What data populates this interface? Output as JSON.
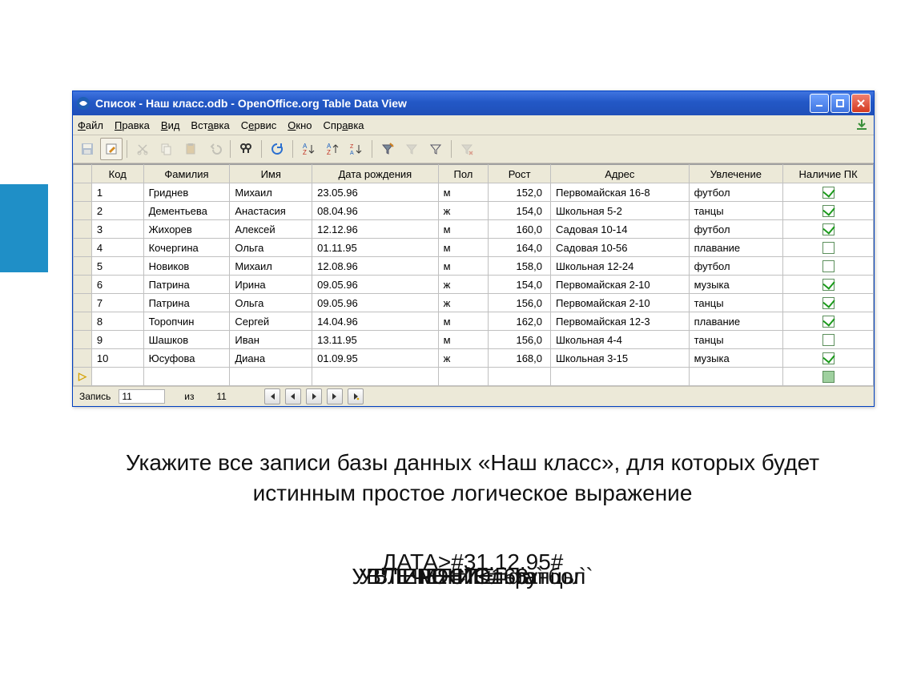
{
  "window": {
    "title": "Список  - Наш класс.odb - OpenOffice.org Table Data View"
  },
  "menu": {
    "file": "Файл",
    "edit": "Правка",
    "view": "Вид",
    "insert": "Вставка",
    "tools": "Сервис",
    "window": "Окно",
    "help": "Справка"
  },
  "columns": {
    "code": "Код",
    "surname": "Фамилия",
    "name": "Имя",
    "birth": "Дата рождения",
    "sex": "Пол",
    "height": "Рост",
    "address": "Адрес",
    "hobby": "Увлечение",
    "pc": "Наличие ПК"
  },
  "rows": [
    {
      "code": "1",
      "surname": "Гриднев",
      "name": "Михаил",
      "birth": "23.05.96",
      "sex": "м",
      "height": "152,0",
      "address": "Первомайская 16-8",
      "hobby": "футбол",
      "pc": true
    },
    {
      "code": "2",
      "surname": "Дементьева",
      "name": "Анастасия",
      "birth": "08.04.96",
      "sex": "ж",
      "height": "154,0",
      "address": "Школьная 5-2",
      "hobby": "танцы",
      "pc": true
    },
    {
      "code": "3",
      "surname": "Жихорев",
      "name": "Алексей",
      "birth": "12.12.96",
      "sex": "м",
      "height": "160,0",
      "address": "Садовая 10-14",
      "hobby": "футбол",
      "pc": true
    },
    {
      "code": "4",
      "surname": "Кочергина",
      "name": "Ольга",
      "birth": "01.11.95",
      "sex": "м",
      "height": "164,0",
      "address": "Садовая 10-56",
      "hobby": "плавание",
      "pc": false
    },
    {
      "code": "5",
      "surname": "Новиков",
      "name": "Михаил",
      "birth": "12.08.96",
      "sex": "м",
      "height": "158,0",
      "address": "Школьная 12-24",
      "hobby": "футбол",
      "pc": false
    },
    {
      "code": "6",
      "surname": "Патрина",
      "name": "Ирина",
      "birth": "09.05.96",
      "sex": "ж",
      "height": "154,0",
      "address": "Первомайская 2-10",
      "hobby": "музыка",
      "pc": true
    },
    {
      "code": "7",
      "surname": "Патрина",
      "name": "Ольга",
      "birth": "09.05.96",
      "sex": "ж",
      "height": "156,0",
      "address": "Первомайская 2-10",
      "hobby": "танцы",
      "pc": true
    },
    {
      "code": "8",
      "surname": "Торопчин",
      "name": "Сергей",
      "birth": "14.04.96",
      "sex": "м",
      "height": "162,0",
      "address": "Первомайская 12-3",
      "hobby": "плавание",
      "pc": true
    },
    {
      "code": "9",
      "surname": "Шашков",
      "name": "Иван",
      "birth": "13.11.95",
      "sex": "м",
      "height": "156,0",
      "address": "Школьная 4-4",
      "hobby": "танцы",
      "pc": false
    },
    {
      "code": "10",
      "surname": "Юсуфова",
      "name": "Диана",
      "birth": "01.09.95",
      "sex": "ж",
      "height": "168,0",
      "address": "Школьная 3-15",
      "hobby": "музыка",
      "pc": true
    }
  ],
  "nav": {
    "record_label": "Запись",
    "current": "11",
    "of_label": "из",
    "total": "11"
  },
  "question": {
    "text": "Укажите все записи базы данных «Наш класс», для которых будет истинным простое логическое выражение",
    "overlay1": "ДАТА>#31.12.95#",
    "overlay2": "УВЛЕЧЕНИЕ=`футбол`",
    "overlay3": "УВЛЕЧЕНИЕ=`танцы`",
    "overlay4": "РОСТ<168",
    "overlay5": "ИМЯ=`Ольга`"
  }
}
